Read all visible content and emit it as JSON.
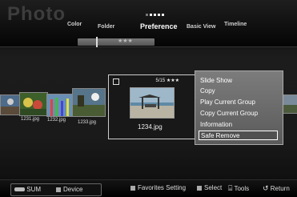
{
  "header": {
    "app_title": "Photo",
    "tabs": [
      {
        "label": "Color"
      },
      {
        "label": "Folder"
      },
      {
        "label": "Preference"
      },
      {
        "label": "Basic View"
      },
      {
        "label": "Timeline"
      }
    ],
    "active_tab": "Preference",
    "page_dots": {
      "total": 5,
      "current": 2
    }
  },
  "grade_bar": {
    "stars": "★★★"
  },
  "files": [
    {
      "name": "1231.jpg"
    },
    {
      "name": "1232.jpg"
    },
    {
      "name": "1233.jpg"
    }
  ],
  "focused": {
    "name": "1234.jpg",
    "counter": "5/15",
    "stars": "★★★"
  },
  "context_menu": {
    "items": [
      "Slide Show",
      "Copy",
      "Play Current Group",
      "Copy Current Group",
      "Information",
      "Safe Remove"
    ],
    "selected": "Safe Remove"
  },
  "footer": {
    "sum_label": "SUM",
    "device_label": "Device",
    "favorites_label": "Favorites Setting",
    "select_label": "Select",
    "tools_label": "Tools",
    "return_label": "Return"
  },
  "colors": {
    "menu_bg": "#6a6a6a",
    "button_a": "#aaaaaa"
  }
}
